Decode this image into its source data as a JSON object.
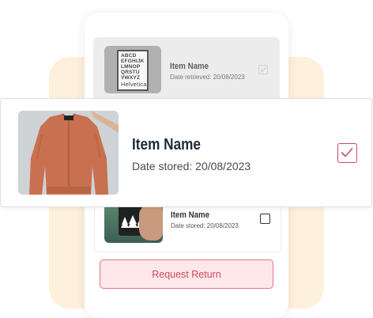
{
  "items": [
    {
      "title": "Item Name",
      "subtitle": "Date retrieved: 20/08/2023",
      "checked": true,
      "image_icon": "helvetica-poster",
      "poster_text": "ABCDEFGHIJKLMNOPQRSTUVWXYZ",
      "poster_lines": [
        "ABCD",
        "EFGHIJK",
        "LMNOP",
        "QRSTU",
        "VWXYZ"
      ],
      "poster_brand": "Helvetica"
    },
    {
      "title": "Item Name",
      "subtitle": "Date stored: 20/08/2023",
      "checked": true,
      "image_icon": "bomber-jacket"
    },
    {
      "title": "Item Name",
      "subtitle": "Date stored: 20/08/2023",
      "checked": false,
      "image_icon": "black-mug-with-trees"
    }
  ],
  "actions": {
    "request_return_label": "Request Return"
  },
  "colors": {
    "accent": "#cc4a5e",
    "button_bg": "#ffe8ea",
    "background_blob": "#fdf0dd",
    "jacket": "#c8704f"
  }
}
